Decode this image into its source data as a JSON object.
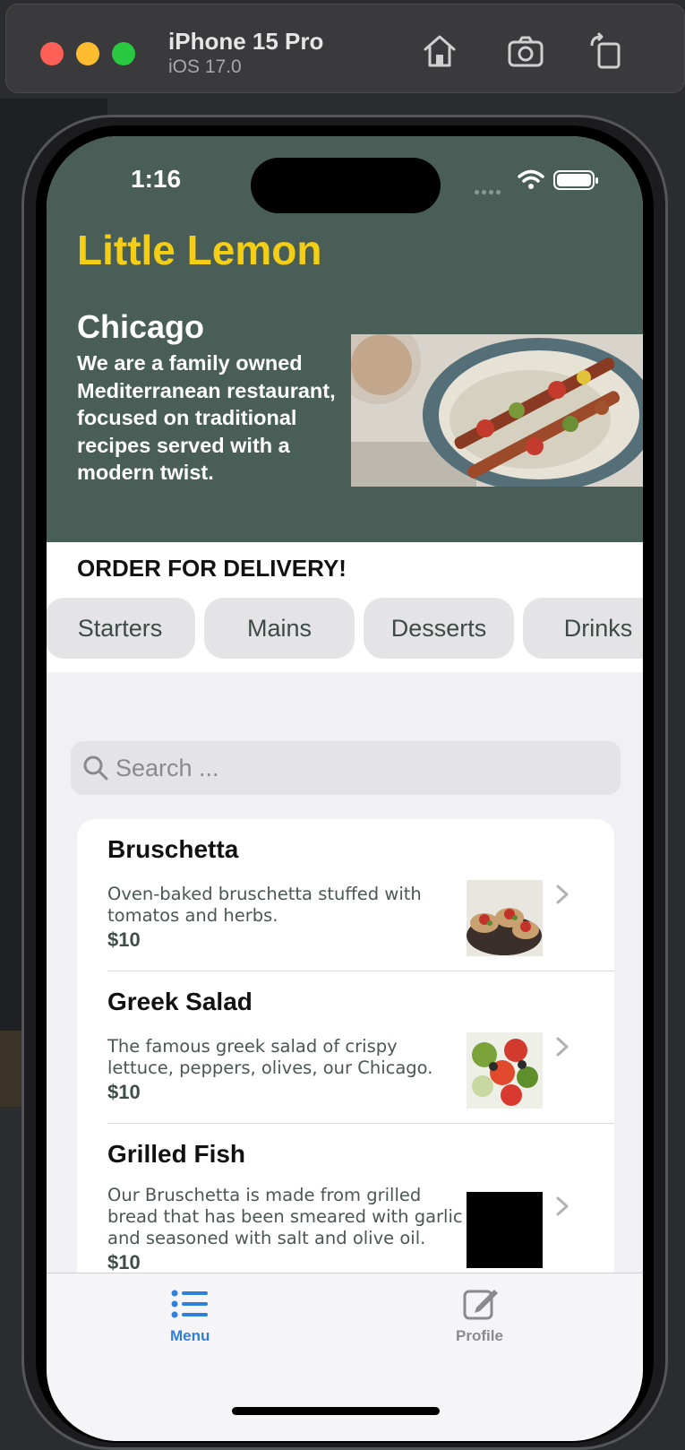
{
  "simulator": {
    "device_name": "iPhone 15 Pro",
    "os_version": "iOS 17.0",
    "toolbar_icons": [
      "home-icon",
      "screenshot-icon",
      "rotate-icon"
    ]
  },
  "status_bar": {
    "time": "1:16"
  },
  "hero": {
    "brand": "Little Lemon",
    "city": "Chicago",
    "tagline": "We are a family owned Mediterranean restaurant, focused on traditional recipes served with a modern twist."
  },
  "order": {
    "title": "ORDER FOR DELIVERY!",
    "categories": [
      "Starters",
      "Mains",
      "Desserts",
      "Drinks"
    ]
  },
  "search": {
    "placeholder": "Search ..."
  },
  "menu_items": [
    {
      "name": "Bruschetta",
      "description": "Oven-baked bruschetta stuffed with tomatos and herbs.",
      "price": "$10"
    },
    {
      "name": "Greek Salad",
      "description": "The famous greek salad of crispy lettuce, peppers, olives, our Chicago.",
      "price": "$10"
    },
    {
      "name": "Grilled Fish",
      "description": "Our Bruschetta is made from grilled bread that has been smeared with garlic and seasoned with salt and olive oil.",
      "price": "$10"
    }
  ],
  "tabbar": {
    "menu_label": "Menu",
    "profile_label": "Profile"
  },
  "colors": {
    "primary_green": "#495e57",
    "primary_yellow": "#f4ce14",
    "tab_active": "#2f7fdc",
    "tab_inactive": "#8a8a8e"
  }
}
